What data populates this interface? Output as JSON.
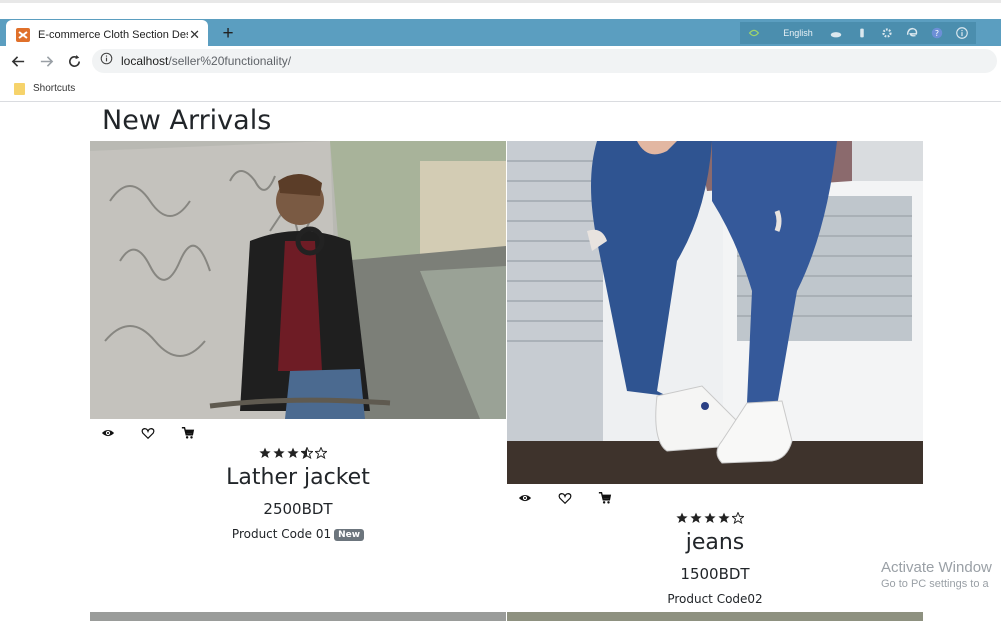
{
  "browser": {
    "tab_title": "E-commerce Cloth Section Desig",
    "url_host": "localhost",
    "url_path": "/seller%20functionality/",
    "language_label": "English",
    "bookmark_label": "Shortcuts"
  },
  "page": {
    "heading": "New Arrivals"
  },
  "products": [
    {
      "name": "Lather jacket",
      "price": "2500BDT",
      "code": "Product Code 01",
      "badge": "New",
      "rating": 3.5
    },
    {
      "name": "jeans",
      "price": "1500BDT",
      "code": "Product Code02",
      "rating": 4
    }
  ],
  "watermark": {
    "line1": "Activate Window",
    "line2": "Go to PC settings to a"
  },
  "colors": {
    "tabbar": "#5b9ec0",
    "badge": "#6c757d",
    "text": "#212529"
  }
}
